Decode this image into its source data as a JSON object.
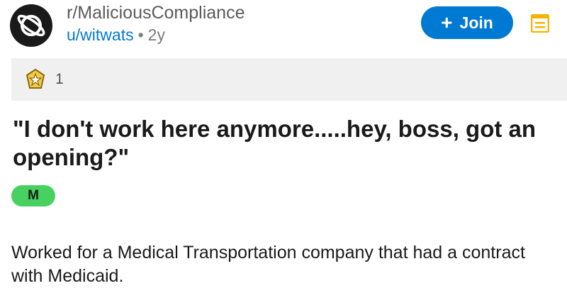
{
  "post": {
    "subreddit": "r/MaliciousCompliance",
    "author": "u/witwats",
    "separator": "•",
    "age": "2y",
    "join_label": "Join",
    "join_plus": "+",
    "awards_count": "1",
    "title": "\"I don't work here anymore.....hey, boss, got an opening?\"",
    "flair": "M",
    "body": "Worked for a Medical Transportation company that had a contract with Medicaid."
  },
  "icons": {
    "subreddit_avatar": "planet-icon",
    "menu": "menu-icon",
    "award": "award-icon"
  },
  "colors": {
    "accent": "#0079d3",
    "flair_bg": "#46d160",
    "menu_icon": "#f4b400",
    "awards_bg": "#f0f0f0"
  }
}
